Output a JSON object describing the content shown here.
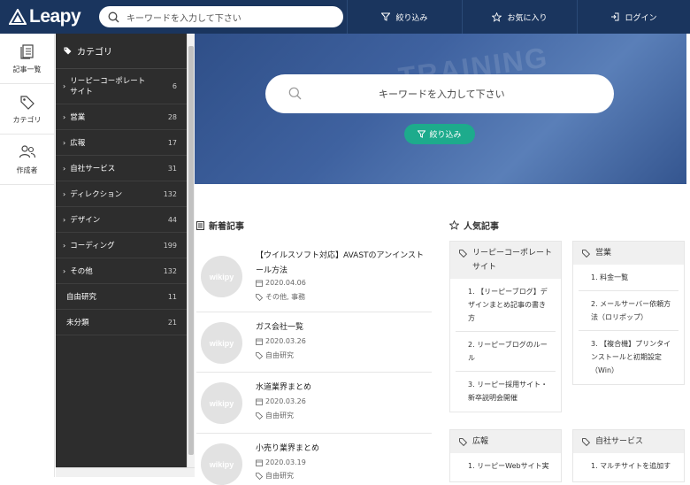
{
  "header": {
    "logo_text": "Leapy",
    "search_placeholder": "キーワードを入力して下さい",
    "filter_label": "絞り込み",
    "favorites_label": "お気に入り",
    "login_label": "ログイン"
  },
  "leftnav": {
    "items": [
      {
        "label": "記事一覧",
        "icon": "articles-icon"
      },
      {
        "label": "カテゴリ",
        "icon": "tag-icon"
      },
      {
        "label": "作成者",
        "icon": "users-icon"
      }
    ]
  },
  "categories": {
    "title": "カテゴリ",
    "items": [
      {
        "label": "リーピーコーポレートサイト",
        "count": "6"
      },
      {
        "label": "営業",
        "count": "28"
      },
      {
        "label": "広報",
        "count": "17"
      },
      {
        "label": "自社サービス",
        "count": "31"
      },
      {
        "label": "ディレクション",
        "count": "132"
      },
      {
        "label": "デザイン",
        "count": "44"
      },
      {
        "label": "コーディング",
        "count": "199"
      },
      {
        "label": "その他",
        "count": "132"
      },
      {
        "label": "自由研究",
        "count": "11"
      },
      {
        "label": "未分類",
        "count": "21"
      }
    ]
  },
  "hero": {
    "search_placeholder": "キーワードを入力して下さい",
    "filter_label": "絞り込み"
  },
  "new_articles": {
    "title": "新着記事",
    "thumb_text": "wikipy",
    "items": [
      {
        "title": "【ウイルスソフト対応】AVASTのアンインストール方法",
        "date": "2020.04.06",
        "tags": "その他, 事務"
      },
      {
        "title": "ガス会社一覧",
        "date": "2020.03.26",
        "tags": "自由研究"
      },
      {
        "title": "水道業界まとめ",
        "date": "2020.03.26",
        "tags": "自由研究"
      },
      {
        "title": "小売り業界まとめ",
        "date": "2020.03.19",
        "tags": "自由研究"
      }
    ]
  },
  "popular": {
    "title": "人気記事",
    "cards": [
      {
        "head": "リーピーコーポレートサイト",
        "items": [
          "1. 【リーピーブログ】デザインまとめ記事の書き方",
          "2. リーピーブログのルール",
          "3. リーピー採用サイト・新卒説明会開催"
        ]
      },
      {
        "head": "営業",
        "items": [
          "1. 料金一覧",
          "2. メールサーバー依頼方法（ロリポップ）",
          "3. 【複合機】プリンタインストールと初期設定（Win）"
        ]
      },
      {
        "head": "広報",
        "items": [
          "1. リーピーWebサイト実"
        ]
      },
      {
        "head": "自社サービス",
        "items": [
          "1. マルチサイトを追加す"
        ]
      }
    ]
  }
}
